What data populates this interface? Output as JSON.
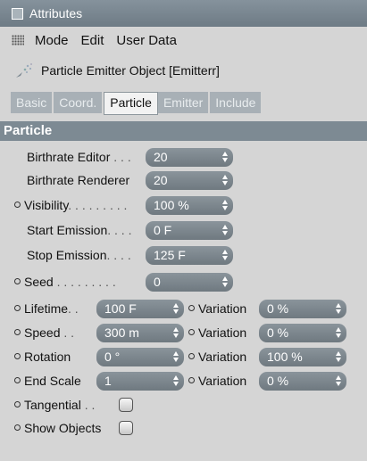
{
  "window": {
    "title": "Attributes"
  },
  "menu": {
    "items": [
      "Mode",
      "Edit",
      "User Data"
    ]
  },
  "object": {
    "title": "Particle Emitter Object [Emitterr]"
  },
  "tabs": [
    {
      "label": "Basic",
      "active": false
    },
    {
      "label": "Coord.",
      "active": false
    },
    {
      "label": "Particle",
      "active": true
    },
    {
      "label": "Emitter",
      "active": false
    },
    {
      "label": "Include",
      "active": false
    }
  ],
  "section": {
    "title": "Particle"
  },
  "params": {
    "birthrate_editor": {
      "label": "Birthrate Editor",
      "dots": " . . .",
      "value": "20"
    },
    "birthrate_renderer": {
      "label": "Birthrate Renderer",
      "value": "20"
    },
    "visibility": {
      "label": "Visibility",
      "dots": ". . . . . . . . .",
      "value": "100 %"
    },
    "start_emission": {
      "label": "Start Emission",
      "dots": ". . . .",
      "value": "0 F"
    },
    "stop_emission": {
      "label": "Stop Emission",
      "dots": ". . . .",
      "value": "125 F"
    },
    "seed": {
      "label": "Seed",
      "dots": " . . . . . . . . .",
      "value": "0"
    },
    "lifetime": {
      "label": "Lifetime",
      "dots": ". .",
      "value": "100 F",
      "variation_label": "Variation",
      "variation": "0 %"
    },
    "speed": {
      "label": "Speed",
      "dots": " . .",
      "value": "300 m",
      "variation_label": "Variation",
      "variation": "0 %"
    },
    "rotation": {
      "label": "Rotation",
      "value": "0 °",
      "variation_label": "Variation",
      "variation": "100 %"
    },
    "end_scale": {
      "label": "End Scale",
      "value": "1",
      "variation_label": "Variation",
      "variation": "0 %"
    },
    "tangential": {
      "label": "Tangential",
      "dots": " . .",
      "checked": false
    },
    "show_objects": {
      "label": "Show Objects",
      "checked": false
    }
  },
  "colors": {
    "field": "#7d878e",
    "section": "#7d8a93",
    "background": "#d5d5d5"
  }
}
